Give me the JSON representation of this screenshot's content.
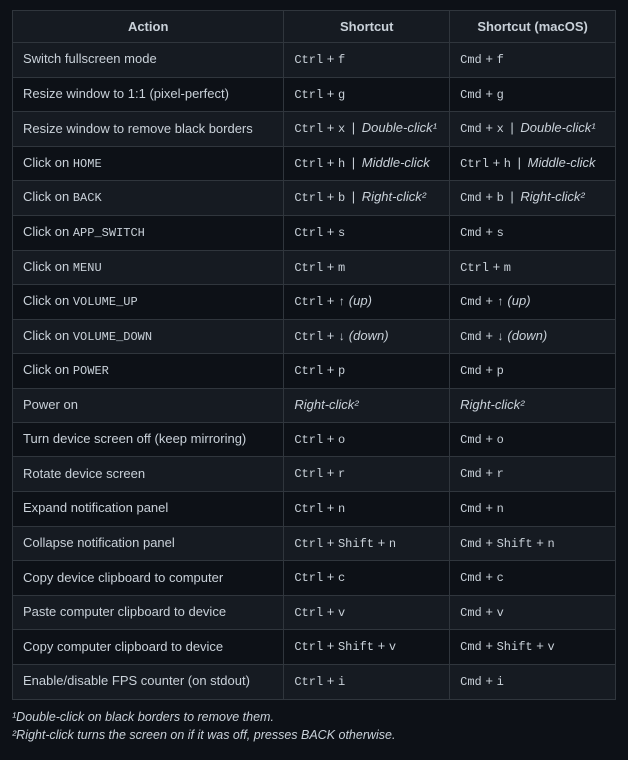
{
  "headers": {
    "action": "Action",
    "shortcut": "Shortcut",
    "shortcut_mac": "Shortcut (macOS)"
  },
  "rows": [
    {
      "action_parts": [
        {
          "t": "text",
          "v": "Switch fullscreen mode"
        }
      ],
      "sc": [
        {
          "t": "code",
          "v": "Ctrl"
        },
        {
          "t": "text",
          "v": " + "
        },
        {
          "t": "code",
          "v": "f"
        }
      ],
      "scm": [
        {
          "t": "code",
          "v": "Cmd"
        },
        {
          "t": "text",
          "v": " + "
        },
        {
          "t": "code",
          "v": "f"
        }
      ]
    },
    {
      "action_parts": [
        {
          "t": "text",
          "v": "Resize window to 1:1 (pixel-perfect)"
        }
      ],
      "sc": [
        {
          "t": "code",
          "v": "Ctrl"
        },
        {
          "t": "text",
          "v": " + "
        },
        {
          "t": "code",
          "v": "g"
        }
      ],
      "scm": [
        {
          "t": "code",
          "v": "Cmd"
        },
        {
          "t": "text",
          "v": " + "
        },
        {
          "t": "code",
          "v": "g"
        }
      ]
    },
    {
      "action_parts": [
        {
          "t": "text",
          "v": "Resize window to remove black borders"
        }
      ],
      "sc": [
        {
          "t": "code",
          "v": "Ctrl"
        },
        {
          "t": "text",
          "v": " + "
        },
        {
          "t": "code",
          "v": "x"
        },
        {
          "t": "sep",
          "v": "|"
        },
        {
          "t": "alt",
          "v": "Double-click¹"
        }
      ],
      "scm": [
        {
          "t": "code",
          "v": "Cmd"
        },
        {
          "t": "text",
          "v": " + "
        },
        {
          "t": "code",
          "v": "x"
        },
        {
          "t": "sep",
          "v": "|"
        },
        {
          "t": "alt",
          "v": "Double-click¹"
        }
      ]
    },
    {
      "action_parts": [
        {
          "t": "text",
          "v": "Click on "
        },
        {
          "t": "code",
          "v": "HOME"
        }
      ],
      "sc": [
        {
          "t": "code",
          "v": "Ctrl"
        },
        {
          "t": "text",
          "v": " + "
        },
        {
          "t": "code",
          "v": "h"
        },
        {
          "t": "sep",
          "v": "|"
        },
        {
          "t": "alt",
          "v": "Middle-click"
        }
      ],
      "scm": [
        {
          "t": "code",
          "v": "Ctrl"
        },
        {
          "t": "text",
          "v": " + "
        },
        {
          "t": "code",
          "v": "h"
        },
        {
          "t": "sep",
          "v": "|"
        },
        {
          "t": "alt",
          "v": "Middle-click"
        }
      ]
    },
    {
      "action_parts": [
        {
          "t": "text",
          "v": "Click on "
        },
        {
          "t": "code",
          "v": "BACK"
        }
      ],
      "sc": [
        {
          "t": "code",
          "v": "Ctrl"
        },
        {
          "t": "text",
          "v": " + "
        },
        {
          "t": "code",
          "v": "b"
        },
        {
          "t": "sep",
          "v": "|"
        },
        {
          "t": "alt",
          "v": "Right-click²"
        }
      ],
      "scm": [
        {
          "t": "code",
          "v": "Cmd"
        },
        {
          "t": "text",
          "v": " + "
        },
        {
          "t": "code",
          "v": "b"
        },
        {
          "t": "sep",
          "v": "|"
        },
        {
          "t": "alt",
          "v": "Right-click²"
        }
      ]
    },
    {
      "action_parts": [
        {
          "t": "text",
          "v": "Click on "
        },
        {
          "t": "code",
          "v": "APP_SWITCH"
        }
      ],
      "sc": [
        {
          "t": "code",
          "v": "Ctrl"
        },
        {
          "t": "text",
          "v": " + "
        },
        {
          "t": "code",
          "v": "s"
        }
      ],
      "scm": [
        {
          "t": "code",
          "v": "Cmd"
        },
        {
          "t": "text",
          "v": " + "
        },
        {
          "t": "code",
          "v": "s"
        }
      ]
    },
    {
      "action_parts": [
        {
          "t": "text",
          "v": "Click on "
        },
        {
          "t": "code",
          "v": "MENU"
        }
      ],
      "sc": [
        {
          "t": "code",
          "v": "Ctrl"
        },
        {
          "t": "text",
          "v": " + "
        },
        {
          "t": "code",
          "v": "m"
        }
      ],
      "scm": [
        {
          "t": "code",
          "v": "Ctrl"
        },
        {
          "t": "text",
          "v": " + "
        },
        {
          "t": "code",
          "v": "m"
        }
      ]
    },
    {
      "action_parts": [
        {
          "t": "text",
          "v": "Click on "
        },
        {
          "t": "code",
          "v": "VOLUME_UP"
        }
      ],
      "sc": [
        {
          "t": "code",
          "v": "Ctrl"
        },
        {
          "t": "text",
          "v": " + "
        },
        {
          "t": "code",
          "v": "↑"
        },
        {
          "t": "altplain",
          "v": " (up)"
        }
      ],
      "scm": [
        {
          "t": "code",
          "v": "Cmd"
        },
        {
          "t": "text",
          "v": " + "
        },
        {
          "t": "code",
          "v": "↑"
        },
        {
          "t": "altplain",
          "v": " (up)"
        }
      ]
    },
    {
      "action_parts": [
        {
          "t": "text",
          "v": "Click on "
        },
        {
          "t": "code",
          "v": "VOLUME_DOWN"
        }
      ],
      "sc": [
        {
          "t": "code",
          "v": "Ctrl"
        },
        {
          "t": "text",
          "v": " + "
        },
        {
          "t": "code",
          "v": "↓"
        },
        {
          "t": "altplain",
          "v": " (down)"
        }
      ],
      "scm": [
        {
          "t": "code",
          "v": "Cmd"
        },
        {
          "t": "text",
          "v": " + "
        },
        {
          "t": "code",
          "v": "↓"
        },
        {
          "t": "altplain",
          "v": " (down)"
        }
      ]
    },
    {
      "action_parts": [
        {
          "t": "text",
          "v": "Click on "
        },
        {
          "t": "code",
          "v": "POWER"
        }
      ],
      "sc": [
        {
          "t": "code",
          "v": "Ctrl"
        },
        {
          "t": "text",
          "v": " + "
        },
        {
          "t": "code",
          "v": "p"
        }
      ],
      "scm": [
        {
          "t": "code",
          "v": "Cmd"
        },
        {
          "t": "text",
          "v": " + "
        },
        {
          "t": "code",
          "v": "p"
        }
      ]
    },
    {
      "action_parts": [
        {
          "t": "text",
          "v": "Power on"
        }
      ],
      "sc": [
        {
          "t": "alt",
          "v": "Right-click²"
        }
      ],
      "scm": [
        {
          "t": "alt",
          "v": "Right-click²"
        }
      ]
    },
    {
      "action_parts": [
        {
          "t": "text",
          "v": "Turn device screen off (keep mirroring)"
        }
      ],
      "sc": [
        {
          "t": "code",
          "v": "Ctrl"
        },
        {
          "t": "text",
          "v": " + "
        },
        {
          "t": "code",
          "v": "o"
        }
      ],
      "scm": [
        {
          "t": "code",
          "v": "Cmd"
        },
        {
          "t": "text",
          "v": " + "
        },
        {
          "t": "code",
          "v": "o"
        }
      ]
    },
    {
      "action_parts": [
        {
          "t": "text",
          "v": "Rotate device screen"
        }
      ],
      "sc": [
        {
          "t": "code",
          "v": "Ctrl"
        },
        {
          "t": "text",
          "v": " + "
        },
        {
          "t": "code",
          "v": "r"
        }
      ],
      "scm": [
        {
          "t": "code",
          "v": "Cmd"
        },
        {
          "t": "text",
          "v": " + "
        },
        {
          "t": "code",
          "v": "r"
        }
      ]
    },
    {
      "action_parts": [
        {
          "t": "text",
          "v": "Expand notification panel"
        }
      ],
      "sc": [
        {
          "t": "code",
          "v": "Ctrl"
        },
        {
          "t": "text",
          "v": " + "
        },
        {
          "t": "code",
          "v": "n"
        }
      ],
      "scm": [
        {
          "t": "code",
          "v": "Cmd"
        },
        {
          "t": "text",
          "v": " + "
        },
        {
          "t": "code",
          "v": "n"
        }
      ]
    },
    {
      "action_parts": [
        {
          "t": "text",
          "v": "Collapse notification panel"
        }
      ],
      "sc": [
        {
          "t": "code",
          "v": "Ctrl"
        },
        {
          "t": "text",
          "v": " + "
        },
        {
          "t": "code",
          "v": "Shift"
        },
        {
          "t": "text",
          "v": " + "
        },
        {
          "t": "code",
          "v": "n"
        }
      ],
      "scm": [
        {
          "t": "code",
          "v": "Cmd"
        },
        {
          "t": "text",
          "v": " + "
        },
        {
          "t": "code",
          "v": "Shift"
        },
        {
          "t": "text",
          "v": " + "
        },
        {
          "t": "code",
          "v": "n"
        }
      ]
    },
    {
      "action_parts": [
        {
          "t": "text",
          "v": "Copy device clipboard to computer"
        }
      ],
      "sc": [
        {
          "t": "code",
          "v": "Ctrl"
        },
        {
          "t": "text",
          "v": " + "
        },
        {
          "t": "code",
          "v": "c"
        }
      ],
      "scm": [
        {
          "t": "code",
          "v": "Cmd"
        },
        {
          "t": "text",
          "v": " + "
        },
        {
          "t": "code",
          "v": "c"
        }
      ]
    },
    {
      "action_parts": [
        {
          "t": "text",
          "v": "Paste computer clipboard to device"
        }
      ],
      "sc": [
        {
          "t": "code",
          "v": "Ctrl"
        },
        {
          "t": "text",
          "v": " + "
        },
        {
          "t": "code",
          "v": "v"
        }
      ],
      "scm": [
        {
          "t": "code",
          "v": "Cmd"
        },
        {
          "t": "text",
          "v": " + "
        },
        {
          "t": "code",
          "v": "v"
        }
      ]
    },
    {
      "action_parts": [
        {
          "t": "text",
          "v": "Copy computer clipboard to device"
        }
      ],
      "sc": [
        {
          "t": "code",
          "v": "Ctrl"
        },
        {
          "t": "text",
          "v": " + "
        },
        {
          "t": "code",
          "v": "Shift"
        },
        {
          "t": "text",
          "v": " + "
        },
        {
          "t": "code",
          "v": "v"
        }
      ],
      "scm": [
        {
          "t": "code",
          "v": "Cmd"
        },
        {
          "t": "text",
          "v": " + "
        },
        {
          "t": "code",
          "v": "Shift"
        },
        {
          "t": "text",
          "v": " + "
        },
        {
          "t": "code",
          "v": "v"
        }
      ]
    },
    {
      "action_parts": [
        {
          "t": "text",
          "v": "Enable/disable FPS counter (on stdout)"
        }
      ],
      "sc": [
        {
          "t": "code",
          "v": "Ctrl"
        },
        {
          "t": "text",
          "v": " + "
        },
        {
          "t": "code",
          "v": "i"
        }
      ],
      "scm": [
        {
          "t": "code",
          "v": "Cmd"
        },
        {
          "t": "text",
          "v": " + "
        },
        {
          "t": "code",
          "v": "i"
        }
      ]
    }
  ],
  "footnotes": [
    "¹Double-click on black borders to remove them.",
    "²Right-click turns the screen on if it was off, presses BACK otherwise."
  ]
}
